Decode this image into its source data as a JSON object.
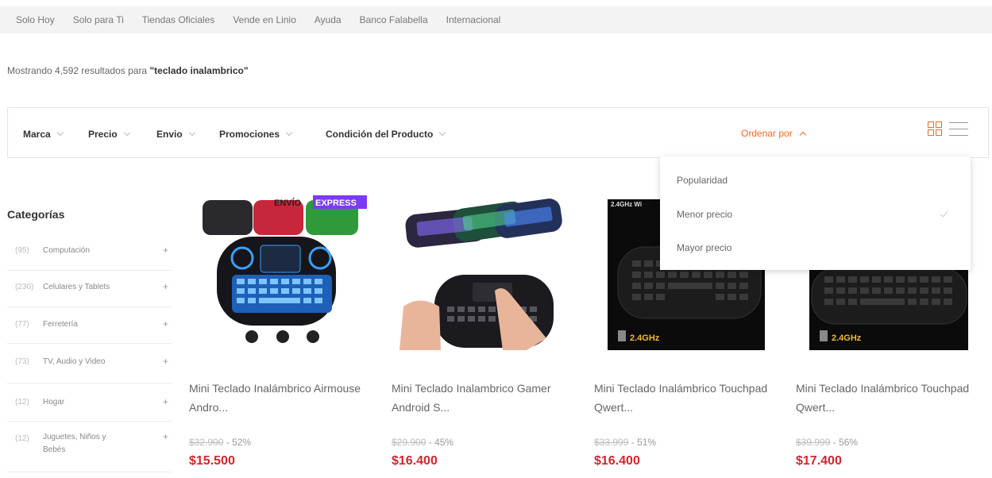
{
  "top_nav": [
    {
      "label": "Solo Hoy"
    },
    {
      "label": "Solo para Ti"
    },
    {
      "label": "Tiendas Oficiales"
    },
    {
      "label": "Vende en Linio"
    },
    {
      "label": "Ayuda"
    },
    {
      "label": "Banco Falabella"
    },
    {
      "label": "Internacional"
    }
  ],
  "results": {
    "prefix": "Mostrando 4,592 resultados para",
    "query": "\"teclado inalambrico\""
  },
  "filters": [
    {
      "label": "Marca"
    },
    {
      "label": "Precio"
    },
    {
      "label": "Envio"
    },
    {
      "label": "Promociones"
    },
    {
      "label": "Condición del Producto"
    }
  ],
  "sort": {
    "label": "Ordenar por",
    "options": [
      {
        "label": "Popularidad"
      },
      {
        "label": "Menor precio"
      },
      {
        "label": "Mayor precio"
      }
    ],
    "selected": "Menor precio"
  },
  "colors": {
    "accent": "#f06b1d",
    "price": "#d0262f"
  },
  "categories": {
    "title": "Categorías",
    "items": [
      {
        "count": "(95)",
        "name": "Computación"
      },
      {
        "count": "(230)",
        "name": "Celulares y Tablets"
      },
      {
        "count": "(77)",
        "name": "Ferretería"
      },
      {
        "count": "(73)",
        "name": "TV, Audio y Video"
      },
      {
        "count": "(12)",
        "name": "Hogar"
      },
      {
        "count": "(12)",
        "name": "Juguetes, Niños y Bebés"
      }
    ]
  },
  "products": [
    {
      "title": "Mini Teclado Inalámbrico Airmouse Andro...",
      "old_price": "$32.900",
      "discount": "- 52%",
      "price": "$15.500",
      "badge_1": "ENVÍO",
      "badge_2": "EXPRESS"
    },
    {
      "title": "Mini Teclado Inalambrico Gamer Android S...",
      "old_price": "$29.900",
      "discount": "- 45%",
      "price": "$16.400"
    },
    {
      "title": "Mini Teclado Inalámbrico Touchpad Qwert...",
      "old_price": "$33.999",
      "discount": "- 51%",
      "price": "$16.400",
      "freq": "2.4GHz",
      "top_label": "2.4GHz Wi"
    },
    {
      "title": "Mini Teclado Inalámbrico Touchpad Qwert...",
      "old_price": "$39.999",
      "discount": "- 56%",
      "price": "$17.400",
      "freq": "2.4GHz"
    }
  ]
}
